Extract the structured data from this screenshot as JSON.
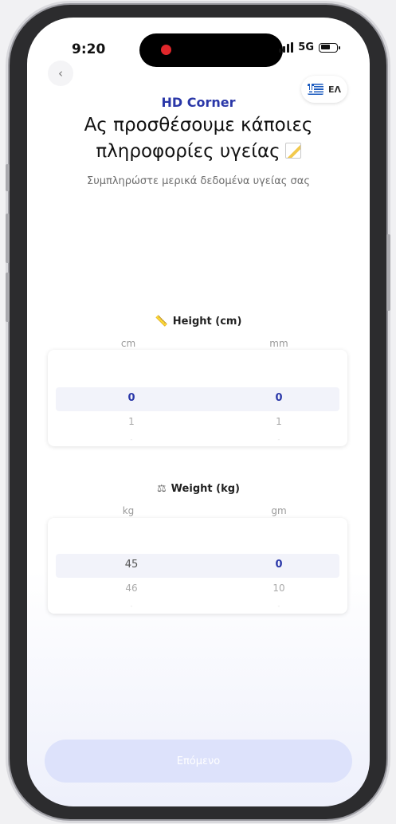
{
  "status": {
    "time": "9:20",
    "network": "5G"
  },
  "header": {
    "back_icon": "chevron-left-icon",
    "language": "ΕΛ",
    "flag": "greece-flag-icon"
  },
  "brand": "HD Corner",
  "title_line1": "Ας προσθέσουμε κάποιες",
  "title_line2": "πληροφορίες υγείας",
  "subtitle": "Συμπληρώστε μερικά δεδομένα υγείας σας",
  "height": {
    "label": "Height (cm)",
    "icon": "ruler-icon",
    "col1_head": "cm",
    "col2_head": "mm",
    "col1_selected": "0",
    "col1_next": "1",
    "col2_selected": "0",
    "col2_next": "1"
  },
  "weight": {
    "label": "Weight (kg)",
    "icon": "scale-icon",
    "col1_head": "kg",
    "col2_head": "gm",
    "col1_selected": "45",
    "col1_next": "46",
    "col2_selected": "0",
    "col2_next": "10"
  },
  "next_button": "Επόμενο",
  "colors": {
    "brand": "#2a37a8",
    "button_disabled": "#dde2fb"
  }
}
